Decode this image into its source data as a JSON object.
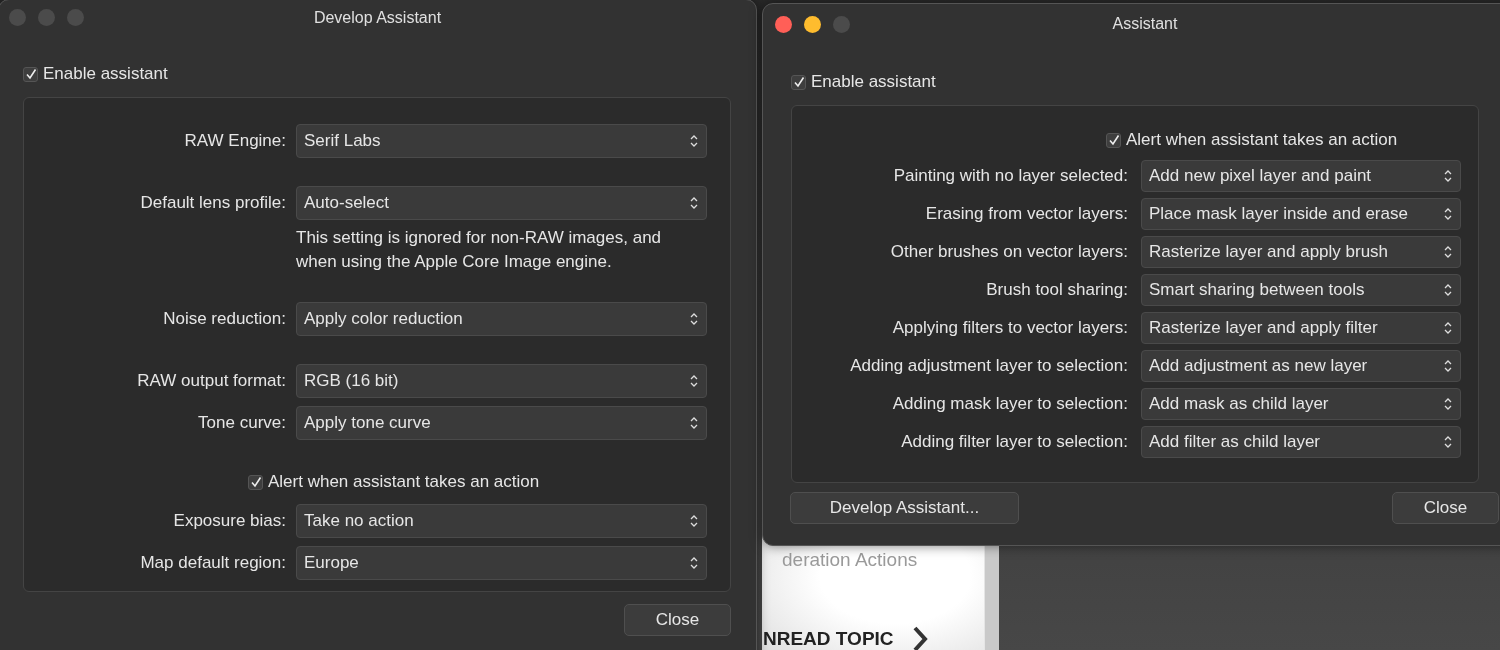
{
  "background_page": {
    "texts": [
      "deration Actions",
      "NREAD TOPIC"
    ]
  },
  "windows": [
    {
      "title": "Develop Assistant",
      "traffic_lights": [
        {
          "color": "#4b4b4b"
        },
        {
          "color": "#4b4b4b"
        },
        {
          "color": "#4b4b4b"
        }
      ],
      "enable": {
        "label": "Enable assistant",
        "checked": true
      },
      "groups": [
        [
          {
            "kind": "select",
            "label": "RAW Engine:",
            "value": "Serif Labs"
          }
        ],
        [
          {
            "kind": "select",
            "label": "Default lens profile:",
            "value": "Auto-select"
          },
          {
            "kind": "note",
            "text": "This setting is ignored for non-RAW images, and when using the Apple Core Image engine."
          }
        ],
        [
          {
            "kind": "select",
            "label": "Noise reduction:",
            "value": "Apply color reduction"
          }
        ],
        [
          {
            "kind": "select",
            "label": "RAW output format:",
            "value": "RGB (16 bit)"
          },
          {
            "kind": "select",
            "label": "Tone curve:",
            "value": "Apply tone curve"
          }
        ],
        [
          {
            "kind": "checkbox",
            "label": "Alert when assistant takes an action",
            "checked": true
          },
          {
            "kind": "select",
            "label": "Exposure bias:",
            "value": "Take no action"
          },
          {
            "kind": "select",
            "label": "Map default region:",
            "value": "Europe"
          }
        ]
      ],
      "right_buttons": [
        "Close"
      ]
    },
    {
      "title": "Assistant",
      "traffic_lights": [
        {
          "color": "#ff5f57"
        },
        {
          "color": "#febc2e"
        },
        {
          "color": "#4b4b4b"
        }
      ],
      "enable": {
        "label": "Enable assistant",
        "checked": true
      },
      "groups": [
        [
          {
            "kind": "checkbox",
            "label": "Alert when assistant takes an action",
            "checked": true
          },
          {
            "kind": "select",
            "label": "Painting with no layer selected:",
            "value": "Add new pixel layer and paint"
          },
          {
            "kind": "select",
            "label": "Erasing from vector layers:",
            "value": "Place mask layer inside and erase"
          },
          {
            "kind": "select",
            "label": "Other brushes on vector layers:",
            "value": "Rasterize layer and apply brush"
          },
          {
            "kind": "select",
            "label": "Brush tool sharing:",
            "value": "Smart sharing between tools"
          },
          {
            "kind": "select",
            "label": "Applying filters to vector layers:",
            "value": "Rasterize layer and apply filter"
          },
          {
            "kind": "select",
            "label": "Adding adjustment layer to selection:",
            "value": "Add adjustment as new layer"
          },
          {
            "kind": "select",
            "label": "Adding mask layer to selection:",
            "value": "Add mask as child layer"
          },
          {
            "kind": "select",
            "label": "Adding filter layer to selection:",
            "value": "Add filter as child layer"
          }
        ]
      ],
      "left_buttons": [
        "Develop Assistant..."
      ],
      "right_buttons": [
        "Close"
      ]
    }
  ]
}
